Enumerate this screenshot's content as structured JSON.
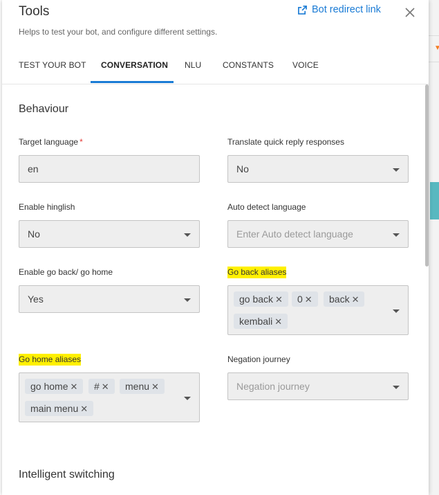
{
  "header": {
    "title": "Tools",
    "subtitle": "Helps to test your bot, and configure different settings.",
    "redirect_label": "Bot redirect link"
  },
  "tabs": [
    {
      "label": "TEST YOUR BOT",
      "active": false
    },
    {
      "label": "CONVERSATION",
      "active": true
    },
    {
      "label": "NLU",
      "active": false
    },
    {
      "label": "CONSTANTS",
      "active": false
    },
    {
      "label": "VOICE",
      "active": false
    }
  ],
  "behaviour": {
    "title": "Behaviour",
    "target_language": {
      "label": "Target language",
      "required": "*",
      "value": "en"
    },
    "translate_quick_reply": {
      "label": "Translate quick reply responses",
      "value": "No"
    },
    "enable_hinglish": {
      "label": "Enable hinglish",
      "value": "No"
    },
    "auto_detect_language": {
      "label": "Auto detect language",
      "placeholder": "Enter Auto detect language"
    },
    "enable_go_back_home": {
      "label": "Enable go back/ go home",
      "value": "Yes"
    },
    "go_back_aliases": {
      "label": "Go back aliases",
      "chips": [
        "go back",
        "0",
        "back",
        "kembali"
      ]
    },
    "go_home_aliases": {
      "label": "Go home aliases",
      "chips": [
        "go home",
        "#",
        "menu",
        "main menu"
      ]
    },
    "negation_journey": {
      "label": "Negation journey",
      "placeholder": "Negation journey"
    }
  },
  "intelligent_switching": {
    "title": "Intelligent switching"
  },
  "colors": {
    "accent": "#1a7bd5",
    "highlight": "#fff000",
    "required": "#e53935"
  },
  "icons": {
    "redirect": "external-link-icon",
    "close": "close-icon",
    "dropdown": "caret-down-icon",
    "chip_remove": "x-icon"
  }
}
